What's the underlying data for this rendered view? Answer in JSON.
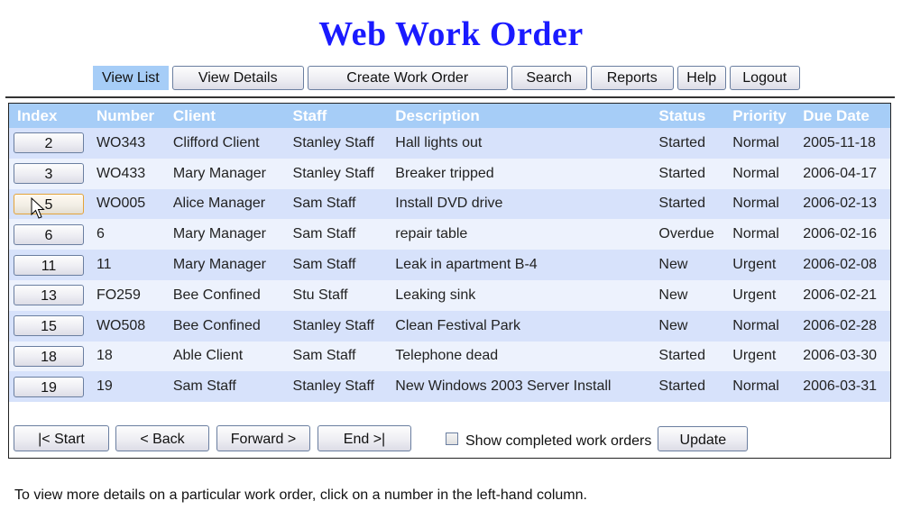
{
  "header": {
    "title": "Web Work Order"
  },
  "nav": {
    "items": [
      {
        "label": "View List",
        "active": true
      },
      {
        "label": "View Details"
      },
      {
        "label": "Create Work Order"
      },
      {
        "label": "Search"
      },
      {
        "label": "Reports"
      },
      {
        "label": "Help"
      },
      {
        "label": "Logout"
      }
    ]
  },
  "table": {
    "columns": [
      "Index",
      "Number",
      "Client",
      "Staff",
      "Description",
      "Status",
      "Priority",
      "Due Date"
    ],
    "rows": [
      {
        "index": "2",
        "number": "WO343",
        "client": "Clifford Client",
        "staff": "Stanley Staff",
        "description": "Hall lights out",
        "status": "Started",
        "priority": "Normal",
        "due": "2005-11-18"
      },
      {
        "index": "3",
        "number": "WO433",
        "client": "Mary Manager",
        "staff": "Stanley Staff",
        "description": "Breaker tripped",
        "status": "Started",
        "priority": "Normal",
        "due": "2006-04-17"
      },
      {
        "index": "5",
        "number": "WO005",
        "client": "Alice Manager",
        "staff": "Sam Staff",
        "description": "Install DVD drive",
        "status": "Started",
        "priority": "Normal",
        "due": "2006-02-13"
      },
      {
        "index": "6",
        "number": "6",
        "client": "Mary Manager",
        "staff": "Sam Staff",
        "description": "repair table",
        "status": "Overdue",
        "priority": "Normal",
        "due": "2006-02-16"
      },
      {
        "index": "11",
        "number": "11",
        "client": "Mary Manager",
        "staff": "Sam Staff",
        "description": "Leak in apartment B-4",
        "status": "New",
        "priority": "Urgent",
        "due": "2006-02-08"
      },
      {
        "index": "13",
        "number": "FO259",
        "client": "Bee Confined",
        "staff": "Stu Staff",
        "description": "Leaking sink",
        "status": "New",
        "priority": "Urgent",
        "due": "2006-02-21"
      },
      {
        "index": "15",
        "number": "WO508",
        "client": "Bee Confined",
        "staff": "Stanley Staff",
        "description": "Clean Festival Park",
        "status": "New",
        "priority": "Normal",
        "due": "2006-02-28"
      },
      {
        "index": "18",
        "number": "18",
        "client": "Able Client",
        "staff": "Sam Staff",
        "description": "Telephone dead",
        "status": "Started",
        "priority": "Urgent",
        "due": "2006-03-30"
      },
      {
        "index": "19",
        "number": "19",
        "client": "Sam Staff",
        "staff": "Stanley Staff",
        "description": "New Windows 2003 Server Install",
        "status": "Started",
        "priority": "Normal",
        "due": "2006-03-31"
      }
    ]
  },
  "footer": {
    "start_label": "|< Start",
    "back_label": "< Back",
    "forward_label": "Forward >",
    "end_label": "End >|",
    "show_completed_label": "Show completed work orders",
    "show_completed_checked": false,
    "update_label": "Update"
  },
  "help_text": "To view more details on a particular work order, click on a number in the left-hand column.",
  "colors": {
    "title": "#1a1aff",
    "header_bg": "#a6cdf7",
    "row_odd": "#d7e2fb",
    "row_even": "#edf2fd"
  }
}
